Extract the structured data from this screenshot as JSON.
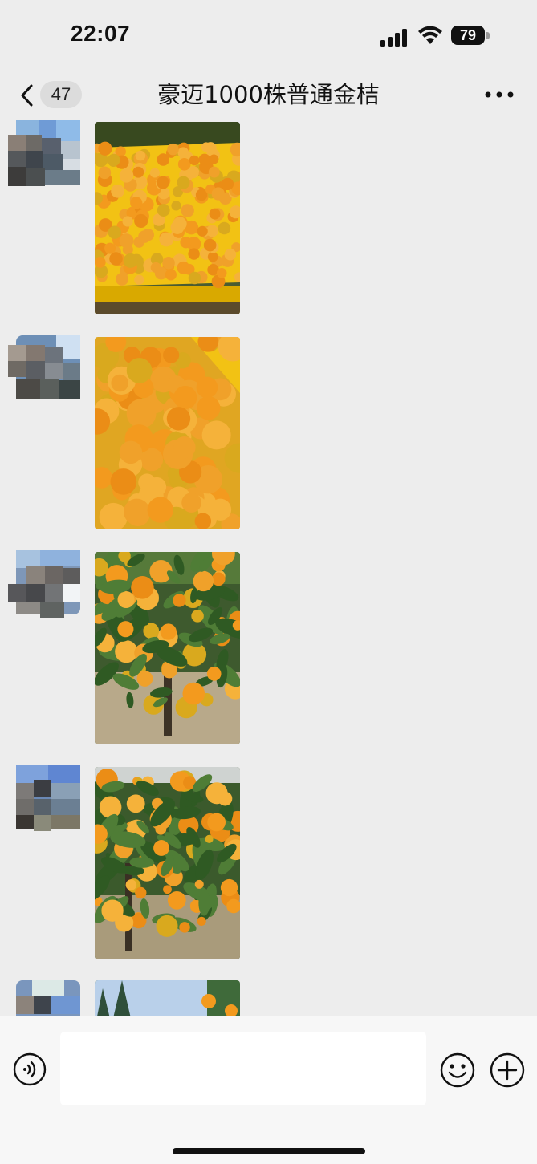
{
  "status_bar": {
    "time": "22:07",
    "battery": "79",
    "icons": [
      "signal-icon",
      "wifi-icon",
      "battery-icon"
    ]
  },
  "header": {
    "back_icon": "chevron-left-icon",
    "unread_count": "47",
    "title": "豪迈1000株普通金桔",
    "more_icon": "more-dots-icon"
  },
  "messages": [
    {
      "sender": "avatar",
      "content": "photo: yellow crate filled with kumquats"
    },
    {
      "sender": "avatar",
      "content": "photo: close-up of kumquats in crate"
    },
    {
      "sender": "avatar",
      "content": "photo: kumquat tree with fruit"
    },
    {
      "sender": "avatar",
      "content": "photo: kumquat tree with many fruits"
    },
    {
      "sender": "avatar",
      "content": "photo: kumquat tree under sky"
    }
  ],
  "input_bar": {
    "voice_icon": "voice-icon",
    "text_value": "",
    "emoji_icon": "emoji-icon",
    "plus_icon": "plus-icon"
  },
  "colors": {
    "background": "#ededed",
    "input_bar": "#f7f7f7",
    "orange": "#f39a1e",
    "crate_yellow": "#f2c214"
  }
}
